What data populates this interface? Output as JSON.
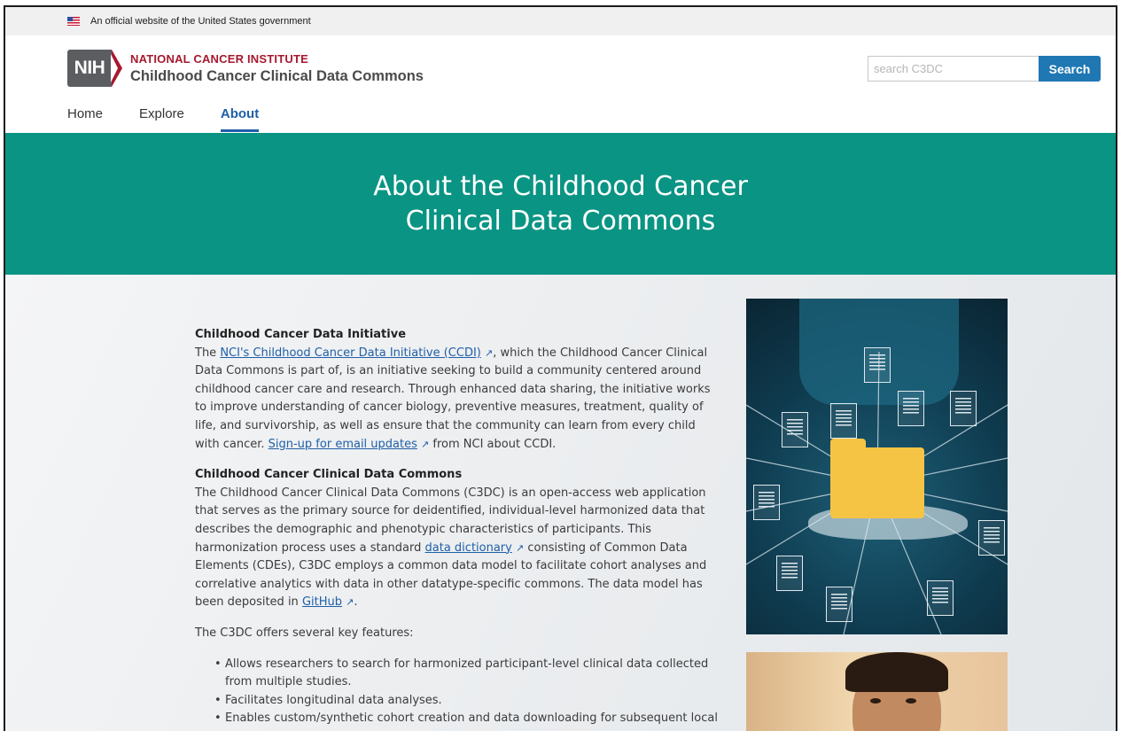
{
  "gov_banner": {
    "text": "An official website of the United States government"
  },
  "header": {
    "logo_text": "NIH",
    "org_name": "NATIONAL CANCER INSTITUTE",
    "site_name": "Childhood Cancer Clinical Data Commons",
    "search_placeholder": "search C3DC",
    "search_button": "Search"
  },
  "nav": {
    "items": [
      {
        "label": "Home",
        "active": false
      },
      {
        "label": "Explore",
        "active": false
      },
      {
        "label": "About",
        "active": true
      }
    ]
  },
  "hero": {
    "title": "About the Childhood Cancer Clinical Data Commons"
  },
  "content": {
    "section1": {
      "heading": "Childhood Cancer Data Initiative",
      "text_1": "The ",
      "link_1": "NCI's Childhood Cancer Data Initiative (CCDI)",
      "text_2": ", which the Childhood Cancer Clinical Data Commons is part of, is an initiative seeking to build a community centered around childhood cancer care and research. Through enhanced data sharing, the initiative works to improve understanding of cancer biology, preventive measures, treatment, quality of life, and survivorship, as well as ensure that the community can learn from every child with cancer. ",
      "link_2": "Sign-up for email updates",
      "text_3": " from NCI about CCDI."
    },
    "section2": {
      "heading": "Childhood Cancer Clinical Data Commons",
      "text_1": "The Childhood Cancer Clinical Data Commons (C3DC) is an open-access web application that serves as the primary source for deidentified, individual-level harmonized data that describes the demographic and phenotypic characteristics of participants. This harmonization process uses a standard ",
      "link_1": "data dictionary",
      "text_2": " consisting of Common Data Elements (CDEs), C3DC employs a common data model to facilitate cohort analyses and correlative analytics with data in other datatype-specific commons. The data model has been deposited in ",
      "link_2": "GitHub",
      "text_3": "."
    },
    "features_intro": "The C3DC offers several key features:",
    "features": [
      "Allows researchers to search for harmonized participant-level clinical data collected from multiple studies.",
      "Facilitates longitudinal data analyses.",
      "Enables custom/synthetic cohort creation and data downloading for subsequent local analyses."
    ]
  },
  "icons": {
    "external_link": "external-link-icon",
    "flag": "us-flag-icon"
  },
  "colors": {
    "hero_bg": "#0a9484",
    "link": "#1f5fa8",
    "search_button": "#1f77b4",
    "org_red": "#a6192e"
  }
}
